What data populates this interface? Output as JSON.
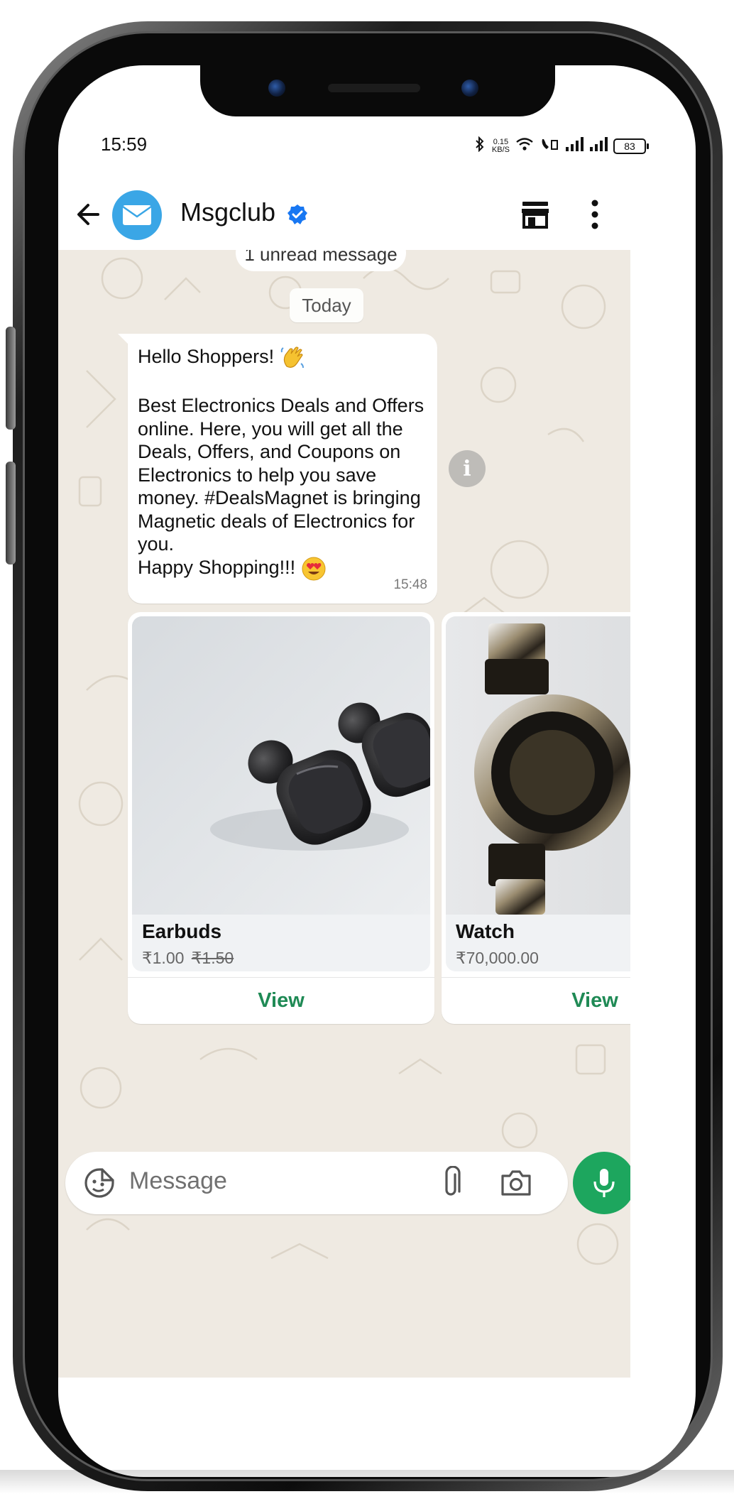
{
  "status_bar": {
    "time": "15:59",
    "net_speed_top": "0.15",
    "net_speed_unit": "KB/S",
    "battery": "83"
  },
  "header": {
    "contact_name": "Msgclub",
    "icons": [
      "back-arrow-icon",
      "avatar",
      "verified-badge-icon",
      "shop-icon",
      "more-vert-icon"
    ]
  },
  "chat": {
    "unread_label": "1 unread message",
    "date_label": "Today",
    "message": {
      "greeting": "Hello Shoppers!",
      "body": "Best Electronics Deals and Offers online. Here, you will get all the Deals, Offers, and Coupons on Electronics to help you save money. #DealsMagnet is bringing Magnetic deals of Electronics for you.",
      "closing": "Happy Shopping!!!",
      "time": "15:48"
    },
    "products": [
      {
        "title": "Earbuds",
        "price": "₹1.00",
        "old_price": "₹1.50",
        "action": "View"
      },
      {
        "title": "Watch",
        "price": "₹70,000.00",
        "old_price": "",
        "action": "View"
      }
    ]
  },
  "composer": {
    "placeholder": "Message"
  },
  "colors": {
    "accent_green": "#1da65e",
    "avatar_blue": "#3aa6e6",
    "chat_bg": "#efeae2",
    "verified_blue": "#1877f2"
  }
}
